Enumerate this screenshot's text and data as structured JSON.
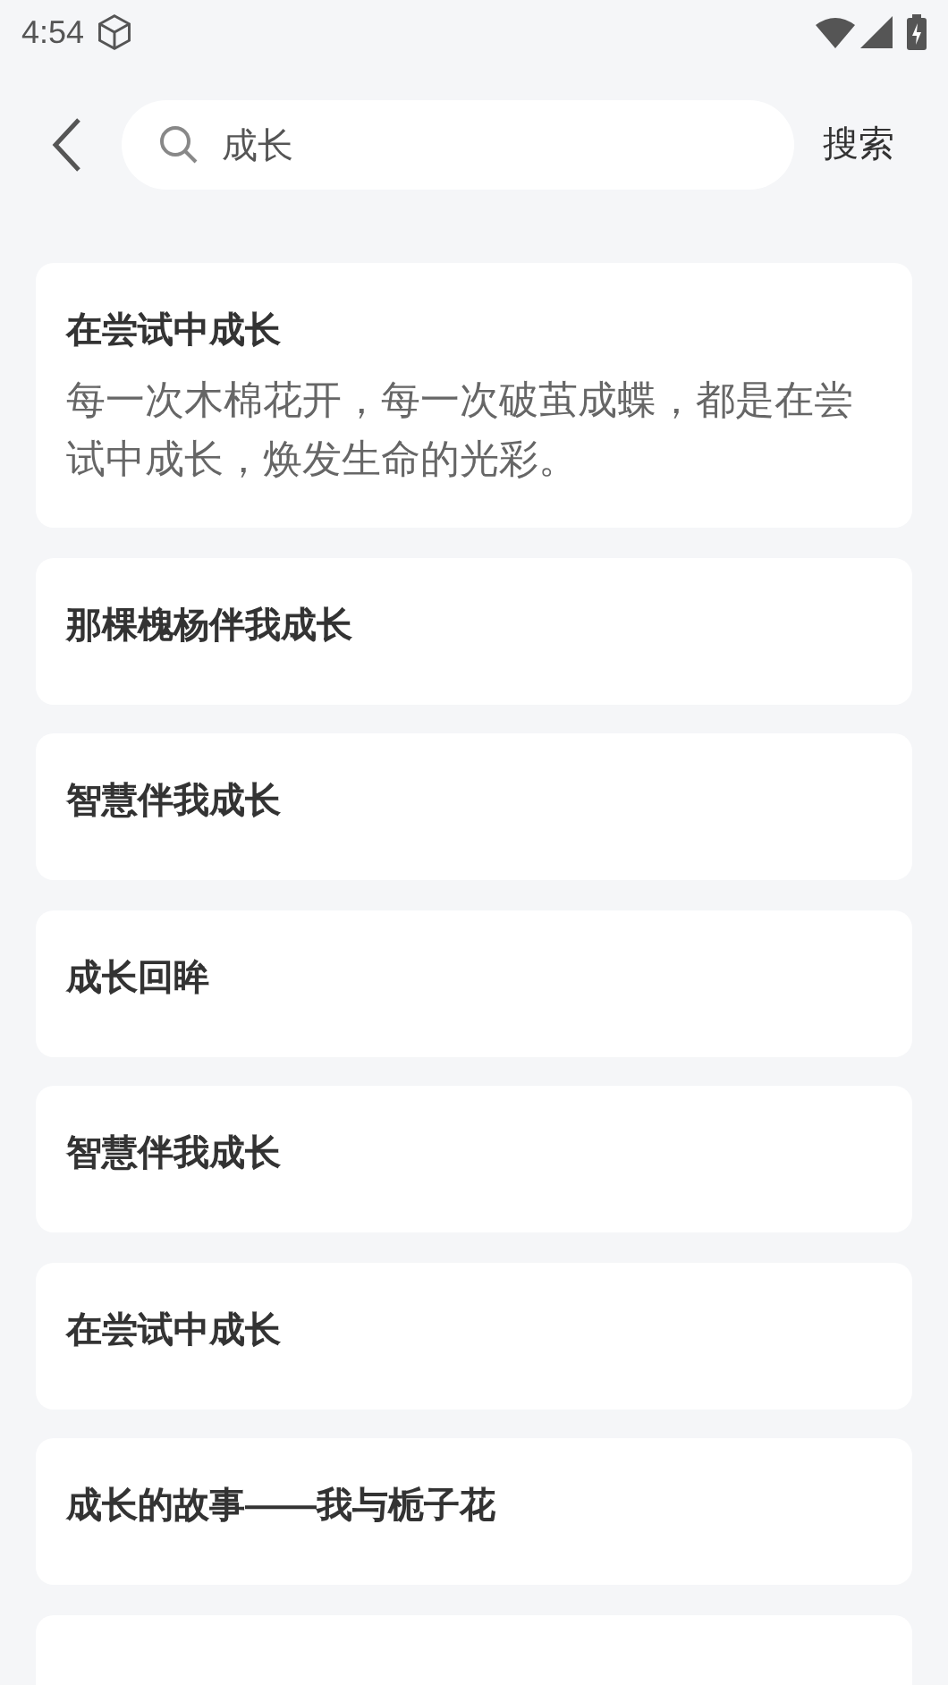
{
  "status_bar": {
    "time": "4:54"
  },
  "search": {
    "value": "成长",
    "button": "搜索"
  },
  "results": [
    {
      "title": "在尝试中成长",
      "snippet": "每一次木棉花开，每一次破茧成蝶，都是在尝试中成长，焕发生命的光彩。"
    },
    {
      "title": "那棵槐杨伴我成长"
    },
    {
      "title": "智慧伴我成长"
    },
    {
      "title": "成长回眸"
    },
    {
      "title": "智慧伴我成长"
    },
    {
      "title": "在尝试中成长"
    },
    {
      "title": "成长的故事——我与栀子花"
    }
  ],
  "more_results_below": true
}
